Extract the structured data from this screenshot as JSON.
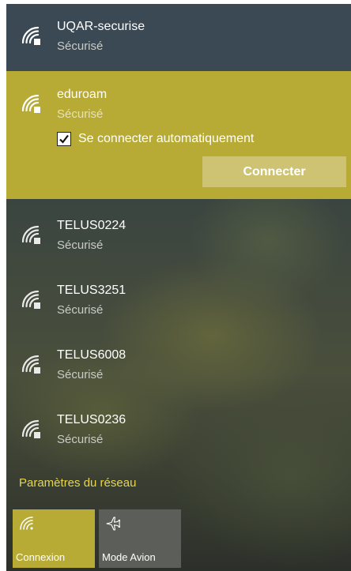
{
  "networks": [
    {
      "name": "UQAR-securise",
      "status": "Sécurisé"
    },
    {
      "name": "eduroam",
      "status": "Sécurisé"
    },
    {
      "name": "TELUS0224",
      "status": "Sécurisé"
    },
    {
      "name": "TELUS3251",
      "status": "Sécurisé"
    },
    {
      "name": "TELUS6008",
      "status": "Sécurisé"
    },
    {
      "name": "TELUS0236",
      "status": "Sécurisé"
    }
  ],
  "selected": {
    "auto_connect_label": "Se connecter automatiquement",
    "auto_connect_checked": true,
    "connect_label": "Connecter"
  },
  "settings_link": "Paramètres du réseau",
  "quick_actions": [
    {
      "label": "Connexion",
      "icon": "wifi-icon",
      "active": true
    },
    {
      "label": "Mode Avion",
      "icon": "airplane-icon",
      "active": false
    }
  ],
  "colors": {
    "accent": "#b7aa35",
    "connect_button": "#cdc373",
    "settings_link": "#e7d64a",
    "top_row_bg": "#3b4955"
  }
}
